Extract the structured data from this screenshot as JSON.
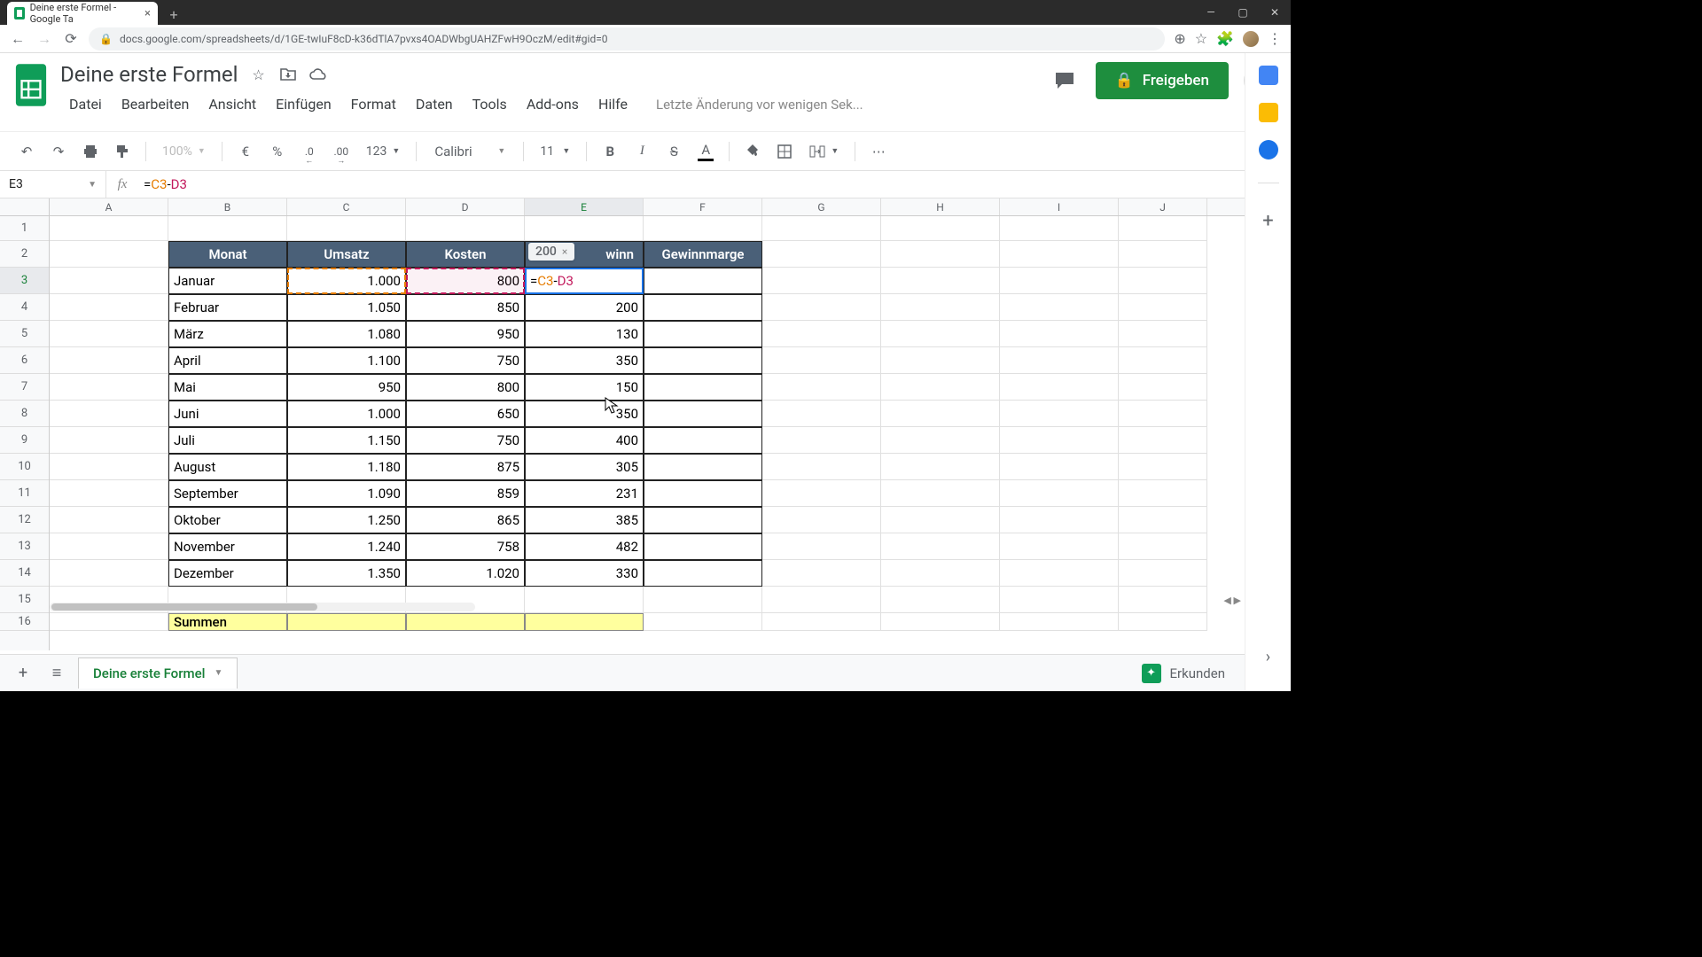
{
  "browser": {
    "tab_title": "Deine erste Formel - Google Ta",
    "url": "docs.google.com/spreadsheets/d/1GE-twIuF8cD-k36dTlA7pvxs4OADWbgUAHZFwH9OczM/edit#gid=0"
  },
  "doc": {
    "title": "Deine erste Formel",
    "menus": [
      "Datei",
      "Bearbeiten",
      "Ansicht",
      "Einfügen",
      "Format",
      "Daten",
      "Tools",
      "Add-ons",
      "Hilfe"
    ],
    "last_edit": "Letzte Änderung vor wenigen Sek...",
    "share_label": "Freigeben"
  },
  "toolbar": {
    "zoom": "100%",
    "currency": "€",
    "pct": "%",
    "dec_dec": ".0",
    "dec_inc": ".00",
    "numfmt": "123",
    "font": "Calibri",
    "size": "11"
  },
  "formula": {
    "cell_ref": "E3",
    "eq": "=",
    "ref1": "C3",
    "op": "-",
    "ref2": "D3",
    "result_preview": "200"
  },
  "columns": [
    "A",
    "B",
    "C",
    "D",
    "E",
    "F",
    "G",
    "H",
    "I",
    "J"
  ],
  "headers": {
    "monat": "Monat",
    "umsatz": "Umsatz",
    "kosten": "Kosten",
    "gewinn": "winn",
    "marge": "Gewinnmarge"
  },
  "rows": [
    {
      "m": "Januar",
      "u": "1.000",
      "k": "800",
      "g": "=C3-D3"
    },
    {
      "m": "Februar",
      "u": "1.050",
      "k": "850",
      "g": "200"
    },
    {
      "m": "März",
      "u": "1.080",
      "k": "950",
      "g": "130"
    },
    {
      "m": "April",
      "u": "1.100",
      "k": "750",
      "g": "350"
    },
    {
      "m": "Mai",
      "u": "950",
      "k": "800",
      "g": "150"
    },
    {
      "m": "Juni",
      "u": "1.000",
      "k": "650",
      "g": "350"
    },
    {
      "m": "Juli",
      "u": "1.150",
      "k": "750",
      "g": "400"
    },
    {
      "m": "August",
      "u": "1.180",
      "k": "875",
      "g": "305"
    },
    {
      "m": "September",
      "u": "1.090",
      "k": "859",
      "g": "231"
    },
    {
      "m": "Oktober",
      "u": "1.250",
      "k": "865",
      "g": "385"
    },
    {
      "m": "November",
      "u": "1.240",
      "k": "758",
      "g": "482"
    },
    {
      "m": "Dezember",
      "u": "1.350",
      "k": "1.020",
      "g": "330"
    }
  ],
  "sum_label": "Summen",
  "sheet": {
    "tab_name": "Deine erste Formel",
    "explore": "Erkunden"
  }
}
